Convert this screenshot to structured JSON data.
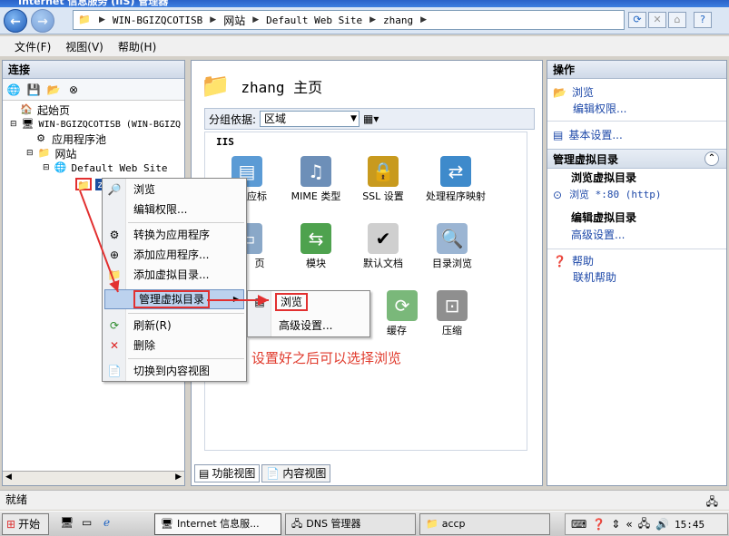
{
  "window": {
    "title": "Internet 信息服务 (IIS) 管理器"
  },
  "address": {
    "segments": [
      "WIN-BGIZQCOTISB",
      "网站",
      "Default Web Site",
      "zhang"
    ]
  },
  "menubar": {
    "items": [
      "文件(F)",
      "视图(V)",
      "帮助(H)"
    ]
  },
  "left": {
    "header": "连接",
    "tree": {
      "start": "起始页",
      "server": "WIN-BGIZQCOTISB (WIN-BGIZQ",
      "apppools": "应用程序池",
      "sites": "网站",
      "default_site": "Default Web Site",
      "node": "zh"
    }
  },
  "center": {
    "title": "zhang 主页",
    "group_label": "分组依据:",
    "group_value": "区域",
    "section": "IIS",
    "features": [
      {
        "label": "应标",
        "icon": "handler-mappings-icon"
      },
      {
        "label": "MIME 类型",
        "icon": "mime-types-icon"
      },
      {
        "label": "SSL 设置",
        "icon": "lock-icon"
      },
      {
        "label": "处理程序映射",
        "icon": "handler-mappings-icon"
      },
      {
        "label": "页",
        "icon": "pages-icon"
      },
      {
        "label": "模块",
        "icon": "modules-icon"
      },
      {
        "label": "默认文档",
        "icon": "default-document-icon"
      },
      {
        "label": "目录浏览",
        "icon": "directory-browsing-icon"
      },
      {
        "label": "缓存",
        "icon": "output-caching-icon"
      },
      {
        "label": "压缩",
        "icon": "compression-icon"
      }
    ],
    "tabs": [
      "功能视图",
      "内容视图"
    ]
  },
  "actions": {
    "header": "操作",
    "browse": "浏览",
    "edit_perms": "编辑权限...",
    "basic_settings": "基本设置...",
    "section_vdir": "管理虚拟目录",
    "browse_vdir_heading": "浏览虚拟目录",
    "browse_port": "浏览 *:80 (http)",
    "edit_vdir_heading": "编辑虚拟目录",
    "advanced": "高级设置...",
    "help": "帮助",
    "online_help": "联机帮助"
  },
  "context_menu": {
    "items": [
      "浏览",
      "编辑权限...",
      "转换为应用程序",
      "添加应用程序...",
      "添加虚拟目录...",
      "管理虚拟目录",
      "刷新(R)",
      "删除",
      "切换到内容视图"
    ]
  },
  "submenu": {
    "items": [
      "浏览",
      "高级设置..."
    ]
  },
  "annotation": "设置好之后可以选择浏览",
  "status": {
    "text": "就绪"
  },
  "taskbar": {
    "start": "开始",
    "tasks": [
      "Internet 信息服...",
      "DNS 管理器",
      "accp"
    ],
    "time": "15:45"
  }
}
